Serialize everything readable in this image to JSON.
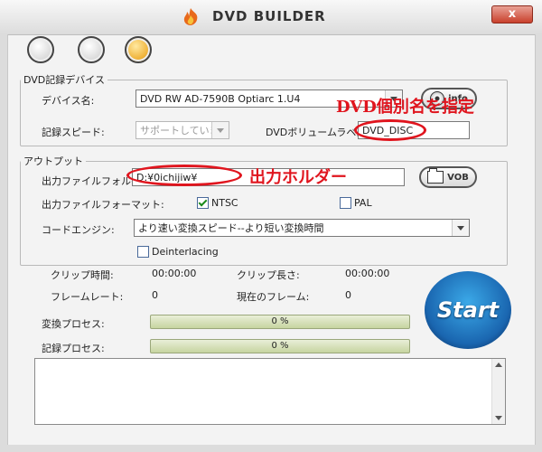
{
  "window": {
    "title": "DVD BUILDER",
    "close_label": "x"
  },
  "device_group": {
    "legend": "DVD記録デバイス",
    "device_label": "デバイス名:",
    "device_value": "DVD RW AD-7590B  Optiarc  1.U4",
    "info_label": "info",
    "speed_label": "記録スピード:",
    "speed_value": "サポートしていま",
    "volume_label": "DVDボリュームラベル",
    "volume_value": "DVD_DISC"
  },
  "output_group": {
    "legend": "アウトプット",
    "folder_label": "出力ファイルフォルダ",
    "folder_value": "D:¥0ichijiw¥",
    "vob_label": "VOB",
    "format_label": "出力ファイルフォーマット:",
    "ntsc_label": "NTSC",
    "pal_label": "PAL",
    "engine_label": "コードエンジン:",
    "engine_value": "より速い変換スピード--より短い変換時間",
    "deinterlace_label": "Deinterlacing"
  },
  "stats": {
    "clip_time_label": "クリップ時間:",
    "clip_time_value": "00:00:00",
    "clip_length_label": "クリップ長さ:",
    "clip_length_value": "00:00:00",
    "frame_rate_label": "フレームレート:",
    "frame_rate_value": "0",
    "current_frame_label": "現在のフレーム:",
    "current_frame_value": "0"
  },
  "progress": {
    "convert_label": "変換プロセス:",
    "convert_text": "0 %",
    "convert_fraction": 0,
    "record_label": "記録プロセス:",
    "record_text": "0 %",
    "record_fraction": 0
  },
  "start_label": "Start",
  "annotations": {
    "dvd_name_note": "DVD個別名を指定",
    "output_folder_note": "出力ホルダー"
  },
  "colors": {
    "annotation_red": "#e0151e",
    "start_blue": "#1a66b0",
    "progress_green": "#6bb33c"
  },
  "icons": [
    "flame-icon",
    "folder-icon",
    "disc-icon",
    "chevron-down-icon"
  ]
}
